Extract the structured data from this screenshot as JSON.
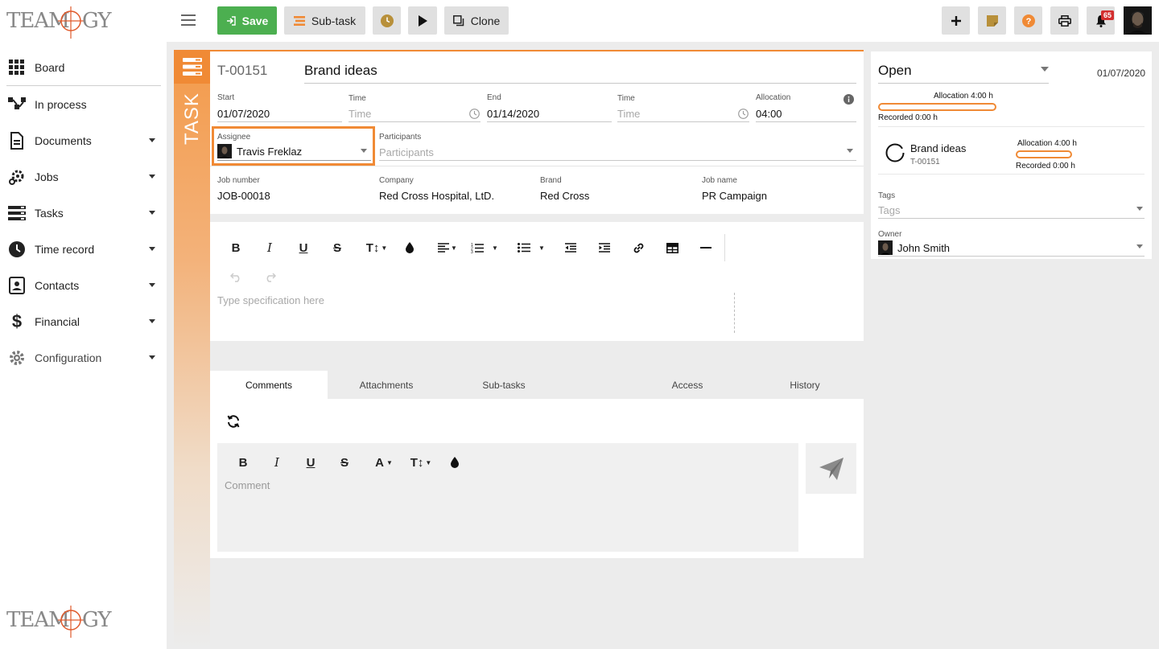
{
  "app": {
    "logo_text": "TEAMOGY"
  },
  "sidebar": {
    "items": [
      {
        "label": "Board",
        "icon": "grid-icon"
      },
      {
        "label": "In process",
        "icon": "flow-icon"
      },
      {
        "label": "Documents",
        "icon": "document-icon"
      },
      {
        "label": "Jobs",
        "icon": "jobs-gear-icon"
      },
      {
        "label": "Tasks",
        "icon": "tasks-icon"
      },
      {
        "label": "Time record",
        "icon": "clock-icon"
      },
      {
        "label": "Contacts",
        "icon": "contacts-icon"
      },
      {
        "label": "Financial",
        "icon": "dollar-icon"
      },
      {
        "label": "Configuration",
        "icon": "gear-icon"
      }
    ]
  },
  "toolbar": {
    "save_label": "Save",
    "subtask_label": "Sub-task",
    "clone_label": "Clone",
    "notifications_count": "65"
  },
  "task": {
    "side_label": "TASK",
    "id": "T-00151",
    "title": "Brand ideas",
    "start_label": "Start",
    "start_value": "01/07/2020",
    "start_time_label": "Time",
    "start_time_placeholder": "Time",
    "end_label": "End",
    "end_value": "01/14/2020",
    "end_time_label": "Time",
    "end_time_placeholder": "Time",
    "allocation_label": "Allocation",
    "allocation_value": "04:00",
    "assignee_label": "Assignee",
    "assignee_value": "Travis Freklaz",
    "participants_label": "Participants",
    "participants_placeholder": "Participants",
    "job_number_label": "Job number",
    "job_number_value": "JOB-00018",
    "company_label": "Company",
    "company_value": "Red Cross Hospital, LtD.",
    "brand_label": "Brand",
    "brand_value": "Red Cross",
    "job_name_label": "Job name",
    "job_name_value": "PR Campaign"
  },
  "editor": {
    "placeholder": "Type specification here"
  },
  "tabs": [
    {
      "label": "Comments"
    },
    {
      "label": "Attachments"
    },
    {
      "label": "Sub-tasks"
    },
    {
      "label": "Access"
    },
    {
      "label": "History"
    }
  ],
  "comment": {
    "placeholder": "Comment"
  },
  "right_panel": {
    "status": "Open",
    "date": "01/07/2020",
    "allocation_text": "Allocation 4:00 h",
    "recorded_text": "Recorded 0:00 h",
    "recorded_fraction": 0,
    "subtask_title": "Brand ideas",
    "subtask_id": "T-00151",
    "subtask_allocation_text": "Allocation 4:00 h",
    "subtask_recorded_text": "Recorded 0:00 h",
    "tags_label": "Tags",
    "tags_placeholder": "Tags",
    "owner_label": "Owner",
    "owner_value": "John Smith"
  },
  "colors": {
    "accent": "#f08a35",
    "save_green": "#4caf50",
    "badge_red": "#d32f2f"
  }
}
